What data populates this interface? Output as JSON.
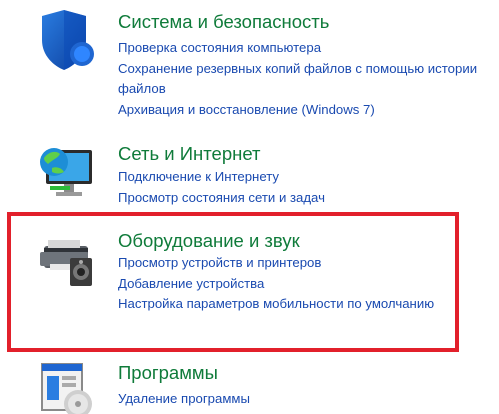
{
  "categories": [
    {
      "title": "Система и безопасность",
      "icon": "shield-icon",
      "links": [
        "Проверка состояния компьютера",
        "Сохранение резервных копий файлов с помощью истории файлов",
        "Архивация и восстановление (Windows 7)"
      ]
    },
    {
      "title": "Сеть и Интернет",
      "icon": "network-globe-icon",
      "links": [
        "Подключение к Интернету",
        "Просмотр состояния сети и задач"
      ]
    },
    {
      "title": "Оборудование и звук",
      "icon": "printer-speaker-icon",
      "links": [
        "Просмотр устройств и принтеров",
        "Добавление устройства",
        "Настройка параметров мобильности по умолчанию"
      ]
    },
    {
      "title": "Программы",
      "icon": "programs-disc-icon",
      "links": [
        "Удаление программы"
      ]
    }
  ],
  "colors": {
    "title": "#0f7b3a",
    "link": "#1a4ab0",
    "highlight": "#e2202b"
  }
}
